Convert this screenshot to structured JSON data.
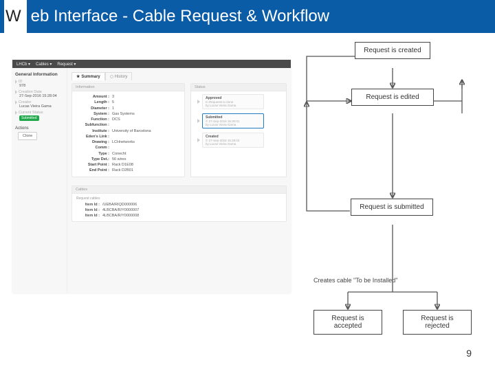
{
  "slide": {
    "title_part1": "W",
    "title_part2": "eb Interface - Cable Request & Workflow",
    "page_number": "9"
  },
  "app": {
    "breadcrumb": [
      "LHCb ▾",
      "Cables ▾",
      "Request ▾"
    ],
    "sidebar": {
      "heading": "General Information",
      "id_label": "ID",
      "id_value": "978",
      "created_label": "Creation Date",
      "created_value": "27-Sep-2016 15:28:04",
      "creator_label": "Creator",
      "creator_value": "Lucas Vieira Gama",
      "status_label": "Current Status",
      "status_badge": "Submitted",
      "actions_heading": "Actions",
      "clone_label": "Clone"
    },
    "tabs": {
      "summary": "Summary",
      "history": "History"
    },
    "info_panel": {
      "heading": "Information",
      "rows": [
        {
          "k": "Amount :",
          "v": "3"
        },
        {
          "k": "Length :",
          "v": "5"
        },
        {
          "k": "Diameter :",
          "v": "1"
        },
        {
          "k": "System :",
          "v": "Gas Systems"
        },
        {
          "k": "Function :",
          "v": "DCS"
        },
        {
          "k": "Subfunction :",
          "v": ""
        },
        {
          "k": "Institute :",
          "v": "University of Barcelona"
        },
        {
          "k": "Eden's Link :",
          "v": ""
        },
        {
          "k": "Drawing :",
          "v": "LCHnetworks"
        },
        {
          "k": "Comm :",
          "v": ""
        },
        {
          "k": "Type :",
          "v": "Conecht"
        },
        {
          "k": "Type Det.:",
          "v": "56 wires"
        },
        {
          "k": "Start Point :",
          "v": "Rack D1E08"
        },
        {
          "k": "End Point :",
          "v": "Rack D2B01"
        }
      ]
    },
    "status_panel": {
      "heading": "Status",
      "items": [
        {
          "title": "Approved",
          "sub1": "In Requests to done",
          "sub2": "by Lucas Vieira Gama",
          "active": false
        },
        {
          "title": "Submitted",
          "sub1": "© 27-Sep-2016 15:30:01",
          "sub2": "by Lucas Vieira Gama",
          "active": true
        },
        {
          "title": "Created",
          "sub1": "© 27-Sep-2016 15:28:04",
          "sub2": "by Lucas Vieira Gama",
          "active": false
        }
      ]
    },
    "cables_panel": {
      "heading": "Cables",
      "subheading": "Request cables",
      "rows": [
        {
          "k": "Item Id :",
          "v": "/UEBA/RIQD000006"
        },
        {
          "k": "Item Id :",
          "v": "4LBCBA/R/Y0000007"
        },
        {
          "k": "Item Id :",
          "v": "4LBCBA/R/Y0000008"
        }
      ]
    }
  },
  "flow": {
    "n1": "Request is created",
    "n2": "Request is edited",
    "n3": "Request is submitted",
    "cap": "Creates cable \"To be Installed\"",
    "n4": "Request is accepted",
    "n5": "Request is rejected"
  }
}
